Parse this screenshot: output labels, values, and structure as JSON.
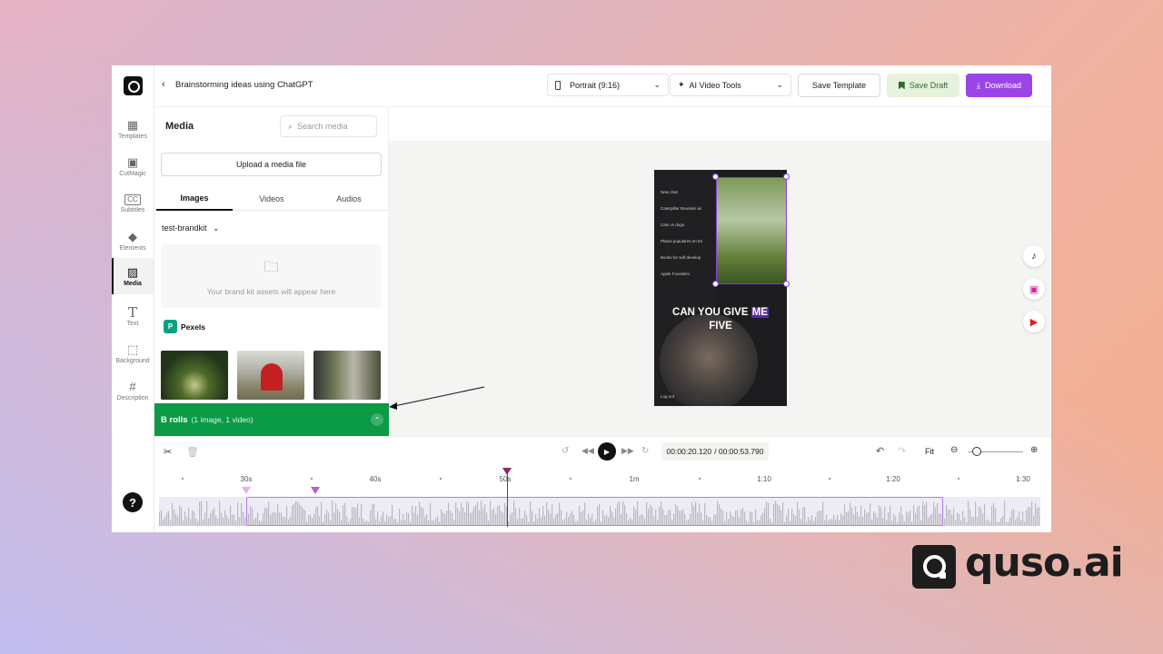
{
  "app": {
    "project_title": "Brainstorming ideas using ChatGPT",
    "aspect_select": "Portrait (9:16)",
    "tools_select": "AI Video Tools",
    "save_template": "Save Template",
    "save_draft": "Save Draft",
    "download": "Download",
    "accent_color": "#9b45e6",
    "broll_color": "#0b9b47"
  },
  "rail": {
    "items": [
      {
        "label": "Templates",
        "icon": "templates-icon"
      },
      {
        "label": "CutMagic",
        "icon": "cutmagic-icon"
      },
      {
        "label": "Subtitles",
        "icon": "subtitles-icon"
      },
      {
        "label": "Elements",
        "icon": "elements-icon"
      },
      {
        "label": "Media",
        "icon": "media-icon"
      },
      {
        "label": "Text",
        "icon": "text-icon"
      },
      {
        "label": "Background",
        "icon": "background-icon"
      },
      {
        "label": "Description",
        "icon": "description-icon"
      }
    ],
    "help": "?"
  },
  "media": {
    "title": "Media",
    "search_placeholder": "Search media",
    "upload": "Upload a media file",
    "tabs": [
      "Images",
      "Videos",
      "Audios"
    ],
    "brandkit": "test-brandkit",
    "brandkit_empty": "Your brand kit assets will appear here",
    "pexels": "Pexels"
  },
  "broll": {
    "title": "B rolls",
    "detail": "(1 image, 1 video)"
  },
  "preview": {
    "caption_line1": "CAN YOU GIVE",
    "caption_highlight": "ME",
    "caption_line2": "FIVE",
    "chat_items": [
      "New chat",
      "Caterpillar Reunites wi",
      "Cats vs dogs.",
      "Platos populares en Es",
      "Books for self develop",
      "Apple Founders."
    ],
    "logout": "Log out"
  },
  "timeline": {
    "current_time": "00:00:20.120",
    "total_time": "/ 00:00:53.790",
    "fit": "Fit",
    "ruler": [
      "30s",
      "40s",
      "50s",
      "1m",
      "1:10",
      "1:20",
      "1:30"
    ]
  },
  "brand": {
    "name": "quso.ai"
  }
}
